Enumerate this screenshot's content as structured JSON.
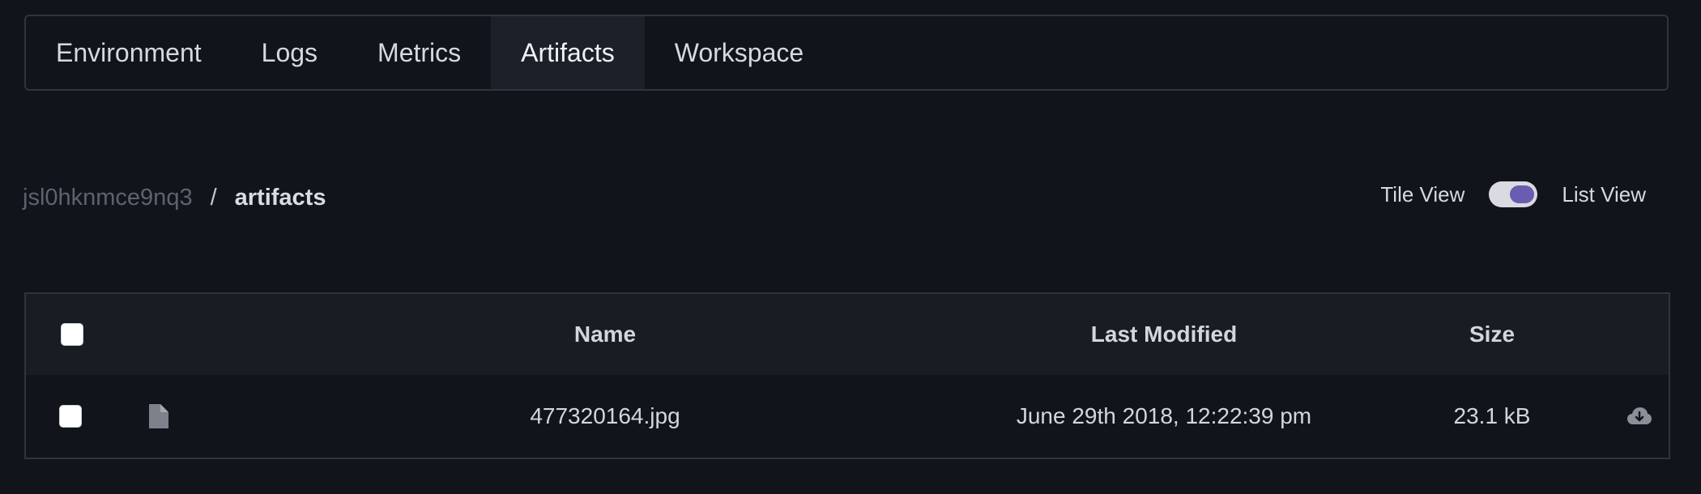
{
  "tabs": [
    {
      "label": "Environment",
      "active": false
    },
    {
      "label": "Logs",
      "active": false
    },
    {
      "label": "Metrics",
      "active": false
    },
    {
      "label": "Artifacts",
      "active": true
    },
    {
      "label": "Workspace",
      "active": false
    }
  ],
  "breadcrumb": {
    "root": "jsl0hknmce9nq3",
    "separator": "/",
    "current": "artifacts"
  },
  "view_toggle": {
    "left_label": "Tile View",
    "right_label": "List View",
    "selected": "List View"
  },
  "table": {
    "headers": {
      "name": "Name",
      "last_modified": "Last Modified",
      "size": "Size"
    },
    "rows": [
      {
        "icon": "file-icon",
        "name": "477320164.jpg",
        "last_modified": "June 29th 2018, 12:22:39 pm",
        "size": "23.1 kB",
        "action_icon": "cloud-download-icon"
      }
    ]
  },
  "colors": {
    "background": "#11141b",
    "accent": "#6a5cb0",
    "border": "#2f343d",
    "header_bg": "#181c23",
    "active_tab_bg": "#1b2029"
  }
}
